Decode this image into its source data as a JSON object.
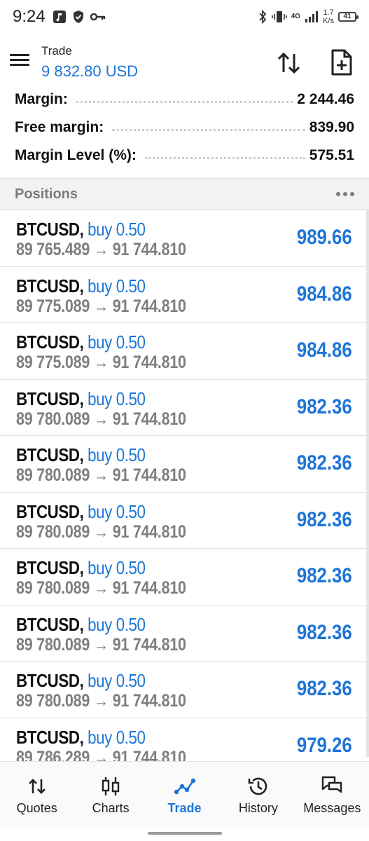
{
  "status_bar": {
    "time": "9:24",
    "network_label": "4G",
    "speed_value": "1.7",
    "speed_unit": "K/s",
    "battery": "41"
  },
  "app_bar": {
    "title": "Trade",
    "balance": "9 832.80 USD"
  },
  "summary": [
    {
      "label": "Margin:",
      "value": "2 244.46"
    },
    {
      "label": "Free margin:",
      "value": "839.90"
    },
    {
      "label": "Margin Level (%):",
      "value": "575.51"
    }
  ],
  "positions": {
    "title": "Positions",
    "items": [
      {
        "symbol": "BTCUSD,",
        "side": "buy 0.50",
        "open": "89 765.489",
        "arrow": "→",
        "current": "91 744.810",
        "profit": "989.66"
      },
      {
        "symbol": "BTCUSD,",
        "side": "buy 0.50",
        "open": "89 775.089",
        "arrow": "→",
        "current": "91 744.810",
        "profit": "984.86"
      },
      {
        "symbol": "BTCUSD,",
        "side": "buy 0.50",
        "open": "89 775.089",
        "arrow": "→",
        "current": "91 744.810",
        "profit": "984.86"
      },
      {
        "symbol": "BTCUSD,",
        "side": "buy 0.50",
        "open": "89 780.089",
        "arrow": "→",
        "current": "91 744.810",
        "profit": "982.36"
      },
      {
        "symbol": "BTCUSD,",
        "side": "buy 0.50",
        "open": "89 780.089",
        "arrow": "→",
        "current": "91 744.810",
        "profit": "982.36"
      },
      {
        "symbol": "BTCUSD,",
        "side": "buy 0.50",
        "open": "89 780.089",
        "arrow": "→",
        "current": "91 744.810",
        "profit": "982.36"
      },
      {
        "symbol": "BTCUSD,",
        "side": "buy 0.50",
        "open": "89 780.089",
        "arrow": "→",
        "current": "91 744.810",
        "profit": "982.36"
      },
      {
        "symbol": "BTCUSD,",
        "side": "buy 0.50",
        "open": "89 780.089",
        "arrow": "→",
        "current": "91 744.810",
        "profit": "982.36"
      },
      {
        "symbol": "BTCUSD,",
        "side": "buy 0.50",
        "open": "89 780.089",
        "arrow": "→",
        "current": "91 744.810",
        "profit": "982.36"
      },
      {
        "symbol": "BTCUSD,",
        "side": "buy 0.50",
        "open": "89 786.289",
        "arrow": "→",
        "current": "91 744.810",
        "profit": "979.26"
      }
    ]
  },
  "bottom_nav": {
    "items": [
      {
        "label": "Quotes",
        "icon": "quotes-arrows-icon",
        "active": false
      },
      {
        "label": "Charts",
        "icon": "candlestick-icon",
        "active": false
      },
      {
        "label": "Trade",
        "icon": "trade-line-icon",
        "active": true
      },
      {
        "label": "History",
        "icon": "history-clock-icon",
        "active": false
      },
      {
        "label": "Messages",
        "icon": "messages-bubbles-icon",
        "active": false
      }
    ]
  },
  "colors": {
    "accent": "#1e75d6",
    "muted": "#7e7e7e"
  }
}
